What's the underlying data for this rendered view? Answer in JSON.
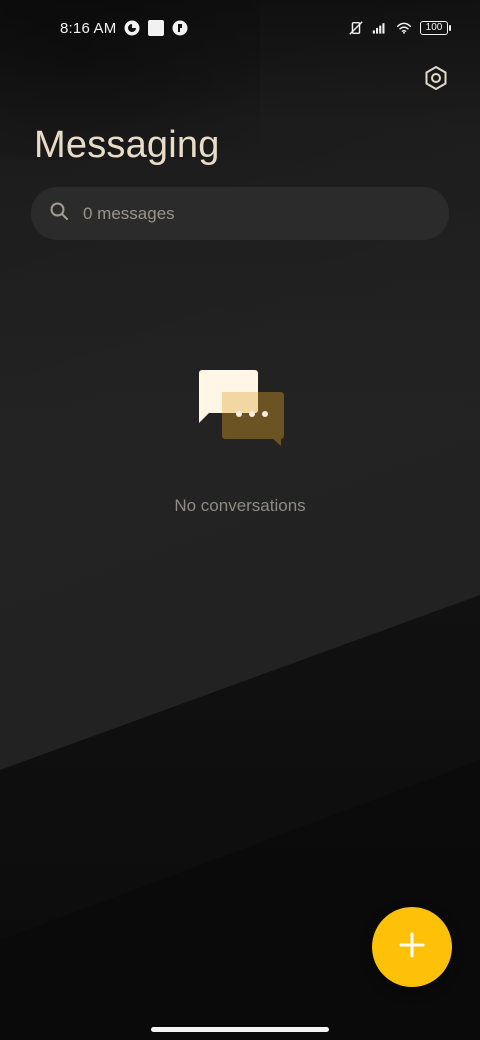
{
  "status_bar": {
    "time": "8:16 AM",
    "battery_level": "100",
    "icons": [
      "app-icon",
      "square-icon",
      "app-icon-2",
      "vibrate-off-icon",
      "signal-icon",
      "wifi-icon",
      "battery-icon"
    ]
  },
  "header": {
    "title": "Messaging",
    "settings_icon": "settings-hex-icon"
  },
  "search": {
    "placeholder": "0 messages",
    "value": ""
  },
  "empty_state": {
    "text": "No conversations",
    "icon": "chat-bubbles-icon"
  },
  "fab": {
    "icon": "plus-icon",
    "color": "#FFC107"
  },
  "colors": {
    "accent": "#FFC107",
    "title": "#E8DCC8",
    "background": "#1F1F1F"
  }
}
